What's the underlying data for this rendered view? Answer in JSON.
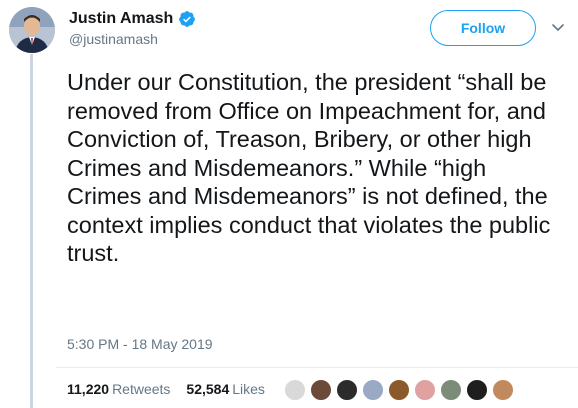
{
  "user": {
    "display_name": "Justin Amash",
    "handle": "@justinamash",
    "verified": true
  },
  "follow_label": "Follow",
  "tweet": {
    "text": "Under our Constitution, the president “shall be removed from Office on Impeachment for, and Conviction of, Treason, Bribery, or other high Crimes and Misdemeanors.” While “high Crimes and Misdemeanors” is not defined, the context implies conduct that violates the public trust.",
    "timestamp": "5:30 PM - 18 May 2019"
  },
  "stats": {
    "retweets_count": "11,220",
    "retweets_label": "Retweets",
    "likes_count": "52,584",
    "likes_label": "Likes"
  },
  "colors": {
    "accent": "#1da1f2",
    "text": "#14171a",
    "secondary_text": "#657786"
  },
  "likers": [
    {
      "icon": "liker-avatar-1",
      "color": "#d9d9d9"
    },
    {
      "icon": "liker-avatar-2",
      "color": "#6b4a3a"
    },
    {
      "icon": "liker-avatar-3",
      "color": "#2b2b2b"
    },
    {
      "icon": "liker-avatar-4",
      "color": "#9aa9c4"
    },
    {
      "icon": "liker-avatar-5",
      "color": "#8a5a2b"
    },
    {
      "icon": "liker-avatar-6",
      "color": "#e0a1a1"
    },
    {
      "icon": "liker-avatar-7",
      "color": "#7d8c7a"
    },
    {
      "icon": "liker-avatar-8",
      "color": "#1e1e1e"
    },
    {
      "icon": "liker-avatar-9",
      "color": "#c28a5c"
    }
  ]
}
